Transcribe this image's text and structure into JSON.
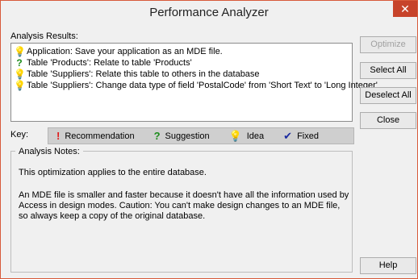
{
  "window": {
    "title": "Performance Analyzer",
    "close_glyph": "✕"
  },
  "results": {
    "label": "Analysis Results:",
    "items": [
      {
        "icon": "idea-icon",
        "glyph": "💡",
        "text": "Application: Save your application as an MDE file."
      },
      {
        "icon": "suggestion-icon",
        "glyph": "?",
        "text": "Table 'Products': Relate to table 'Products'"
      },
      {
        "icon": "idea-icon",
        "glyph": "💡",
        "text": "Table 'Suppliers': Relate this table to others in the database"
      },
      {
        "icon": "idea-icon",
        "glyph": "💡",
        "text": "Table 'Suppliers': Change data type of field 'PostalCode' from 'Short Text' to 'Long Integer'"
      }
    ]
  },
  "buttons": {
    "optimize": "Optimize",
    "select_all": "Select All",
    "deselect_all": "Deselect All",
    "close": "Close",
    "help": "Help"
  },
  "key": {
    "label": "Key:",
    "recommendation": {
      "glyph": "!",
      "text": "Recommendation"
    },
    "suggestion": {
      "glyph": "?",
      "text": "Suggestion"
    },
    "idea": {
      "glyph": "💡",
      "text": "Idea"
    },
    "fixed": {
      "glyph": "✔",
      "text": "Fixed"
    }
  },
  "notes": {
    "label": "Analysis Notes:",
    "paragraph1": "This optimization applies to the entire database.",
    "paragraph2": "An MDE file is smaller and faster because it doesn't have all the information used by Access in design modes. Caution: You can't make design changes to an MDE file, so always keep a copy of the original database."
  },
  "colors": {
    "recommendation": "#e01b1b",
    "suggestion": "#1c8c1c",
    "idea": "#e0b400",
    "fixed": "#1b2aa0",
    "close_button": "#c7432a"
  }
}
